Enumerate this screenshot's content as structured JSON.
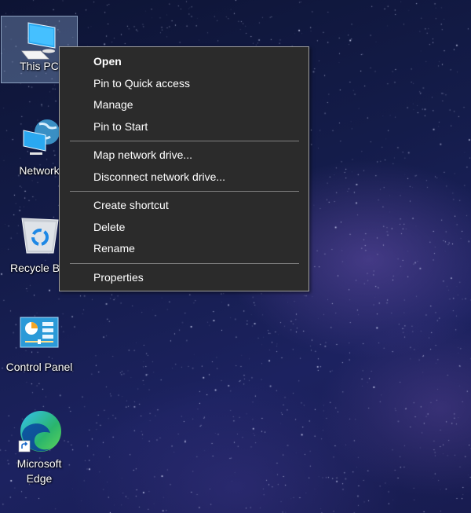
{
  "desktop": {
    "icons": [
      {
        "label": "This PC",
        "icon": "computer-icon",
        "selected": true
      },
      {
        "label": "Network",
        "icon": "network-icon",
        "selected": false
      },
      {
        "label": "Recycle Bin",
        "icon": "recycle-bin-icon",
        "selected": false
      },
      {
        "label": "Control Panel",
        "icon": "control-panel-icon",
        "selected": false
      },
      {
        "label": "Microsoft Edge",
        "icon": "edge-icon",
        "shortcut": true,
        "selected": false
      }
    ]
  },
  "context_menu": {
    "groups": [
      [
        {
          "label": "Open",
          "default": true
        },
        {
          "label": "Pin to Quick access"
        },
        {
          "label": "Manage"
        },
        {
          "label": "Pin to Start"
        }
      ],
      [
        {
          "label": "Map network drive..."
        },
        {
          "label": "Disconnect network drive..."
        }
      ],
      [
        {
          "label": "Create shortcut"
        },
        {
          "label": "Delete"
        },
        {
          "label": "Rename"
        }
      ],
      [
        {
          "label": "Properties"
        }
      ]
    ]
  },
  "colors": {
    "menu_bg": "#2b2b2b",
    "menu_border": "#a0a0a0",
    "menu_text": "#ffffff",
    "separator": "#808080"
  }
}
